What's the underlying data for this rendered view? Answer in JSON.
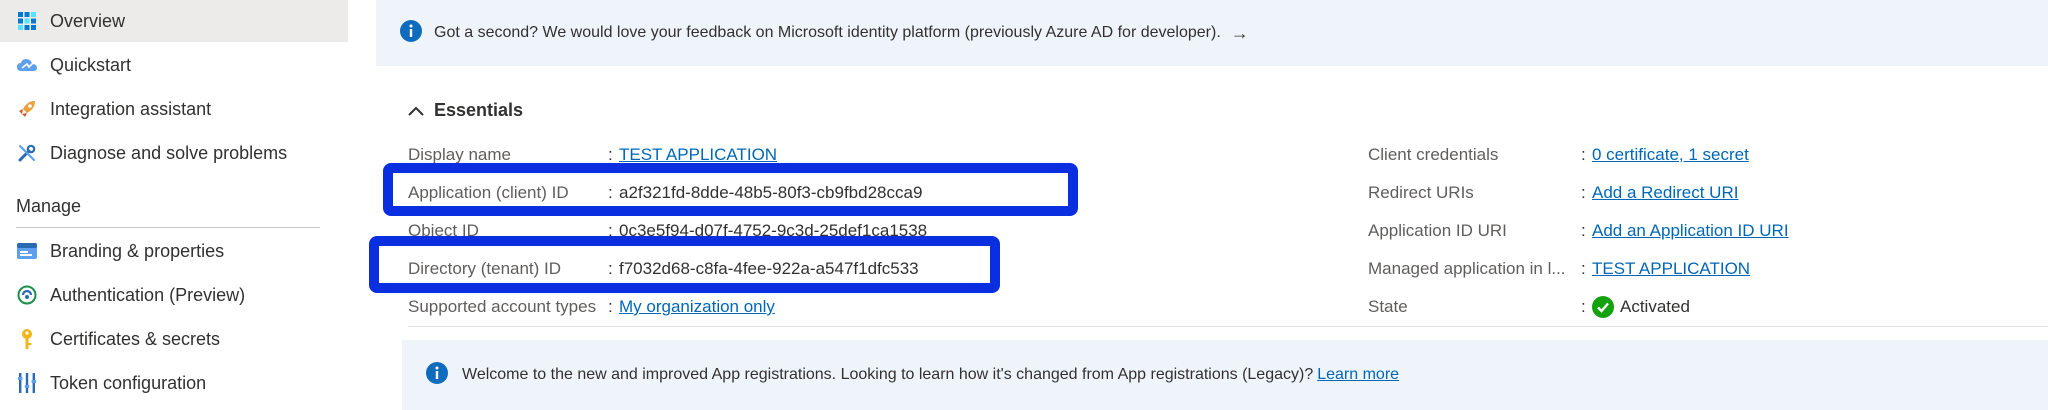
{
  "sidebar": {
    "items": [
      {
        "label": "Overview",
        "icon": "overview-grid-icon",
        "active": true
      },
      {
        "label": "Quickstart",
        "icon": "quickstart-cloud-icon"
      },
      {
        "label": "Integration assistant",
        "icon": "rocket-icon"
      },
      {
        "label": "Diagnose and solve problems",
        "icon": "wrench-icon"
      }
    ],
    "manage_heading": "Manage",
    "manage_items": [
      {
        "label": "Branding & properties",
        "icon": "branding-card-icon"
      },
      {
        "label": "Authentication (Preview)",
        "icon": "authentication-icon"
      },
      {
        "label": "Certificates & secrets",
        "icon": "key-icon"
      },
      {
        "label": "Token configuration",
        "icon": "token-bars-icon"
      }
    ]
  },
  "feedback_banner": {
    "text": "Got a second? We would love your feedback on Microsoft identity platform (previously Azure AD for developer).",
    "arrow": "→"
  },
  "essentials": {
    "title": "Essentials",
    "left": [
      {
        "label": "Display name",
        "value": "TEST APPLICATION",
        "link": true
      },
      {
        "label": "Application (client) ID",
        "value": "a2f321fd-8dde-48b5-80f3-cb9fbd28cca9",
        "link": false
      },
      {
        "label": "Object ID",
        "value": "0c3e5f94-d07f-4752-9c3d-25def1ca1538",
        "link": false
      },
      {
        "label": "Directory (tenant) ID",
        "value": "f7032d68-c8fa-4fee-922a-a547f1dfc533",
        "link": false
      },
      {
        "label": "Supported account types",
        "value": "My organization only",
        "link": true
      }
    ],
    "right": [
      {
        "label": "Client credentials",
        "value": "0 certificate, 1 secret",
        "link": true
      },
      {
        "label": "Redirect URIs",
        "value": "Add a Redirect URI",
        "link": true
      },
      {
        "label": "Application ID URI",
        "value": "Add an Application ID URI",
        "link": true
      },
      {
        "label": "Managed application in l...",
        "value": "TEST APPLICATION",
        "link": true
      },
      {
        "label": "State",
        "value": "Activated",
        "link": false,
        "status_icon": "check-circle-icon"
      }
    ],
    "colon": ":"
  },
  "legacy_banner": {
    "text": "Welcome to the new and improved App registrations. Looking to learn how it's changed from App registrations (Legacy)?",
    "link": "Learn more"
  },
  "colors": {
    "highlight": "#0a2fe0",
    "link": "#0067b8",
    "banner": "#eff4fb",
    "success": "#13a10e"
  }
}
